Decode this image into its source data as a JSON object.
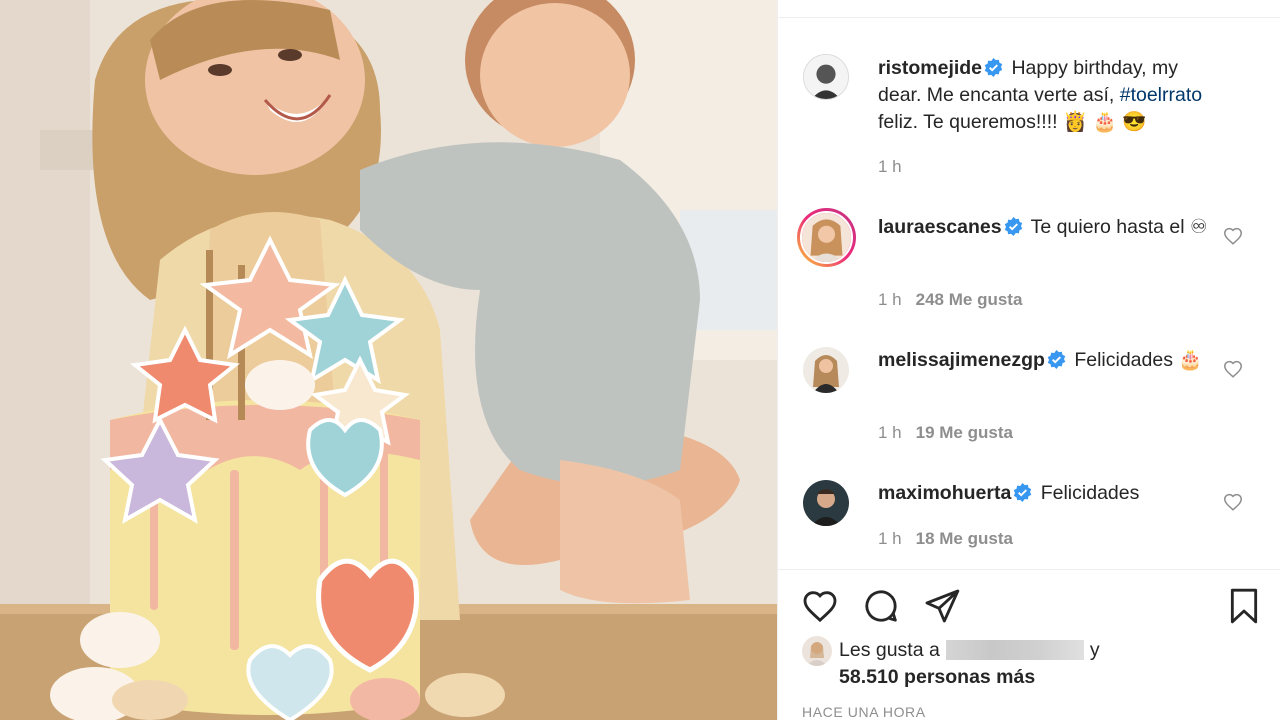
{
  "post": {
    "caption": {
      "username": "ristomejide",
      "text_before": "Happy birthday, my dear. Me encanta verte así,",
      "hashtag": "#toelrrato",
      "text_after": "feliz. Te queremos!!!! 👸 🎂 😎",
      "time": "1 h"
    },
    "comments": [
      {
        "username": "lauraescanes",
        "text": "Te quiero hasta el ♾",
        "time": "1 h",
        "likes": "248 Me gusta"
      },
      {
        "username": "melissajimenezgp",
        "text": "Felicidades 🎂",
        "time": "1 h",
        "likes": "19 Me gusta"
      },
      {
        "username": "maximohuerta",
        "text": "Felicidades",
        "time": "1 h",
        "likes": "18 Me gusta"
      }
    ],
    "likes_prefix": "Les gusta a",
    "likes_suffix": "y",
    "likes_count": "58.510 personas más",
    "timestamp": "HACE UNA HORA"
  },
  "colors": {
    "verified": "#3897f0",
    "hashtag": "#00376b",
    "secondary": "#8e8e8e",
    "story_ring": "#e1306c"
  },
  "icons": [
    "verified-badge-icon",
    "heart-icon",
    "comment-icon",
    "share-icon",
    "bookmark-icon"
  ]
}
